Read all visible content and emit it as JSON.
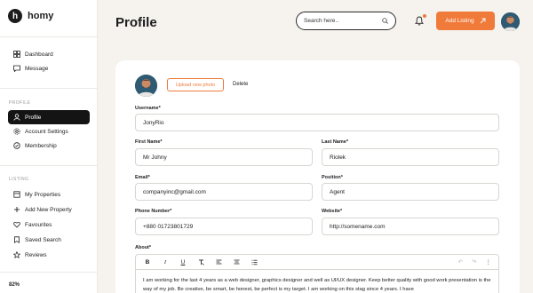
{
  "brand": {
    "name": "homy",
    "mark": "h"
  },
  "sidebar": {
    "main_items": [
      {
        "label": "Dashboard",
        "icon": "dashboard-icon"
      },
      {
        "label": "Message",
        "icon": "message-icon"
      }
    ],
    "profile_section": "PROFILE",
    "profile_items": [
      {
        "label": "Profile",
        "icon": "user-icon",
        "active": true
      },
      {
        "label": "Account Settings",
        "icon": "gear-icon"
      },
      {
        "label": "Membership",
        "icon": "membership-icon"
      }
    ],
    "listing_section": "LISTING",
    "listing_items": [
      {
        "label": "My Properties",
        "icon": "properties-icon"
      },
      {
        "label": "Add New Property",
        "icon": "plus-icon"
      },
      {
        "label": "Favourites",
        "icon": "heart-icon"
      },
      {
        "label": "Saved Search",
        "icon": "bookmark-icon"
      },
      {
        "label": "Reviews",
        "icon": "star-icon"
      }
    ],
    "progress": "82%"
  },
  "header": {
    "title": "Profile",
    "search_placeholder": "Search here..",
    "add_listing_label": "Add Listing"
  },
  "profile": {
    "upload_label": "Upload new photo",
    "delete_label": "Delete",
    "username_label": "Username*",
    "username_value": "JonyRio",
    "first_name_label": "First Name*",
    "first_name_value": "Mr Johny",
    "last_name_label": "Last Name*",
    "last_name_value": "Riolek",
    "email_label": "Email*",
    "email_value": "companyinc@gmail.com",
    "position_label": "Position*",
    "position_value": "Agent",
    "phone_label": "Phone Number*",
    "phone_value": "+880 01723801729",
    "website_label": "Website*",
    "website_value": "http://somename.com",
    "about_label": "About*",
    "about_text": "I am working for the last 4 years as a web designer, graphics designer and well as UI/UX designer. Keep better quality with good work presentation is the way of my job. Be creative, be smart, be honest, be perfect is my target. I am working on this stag since 4 years. I have"
  },
  "colors": {
    "accent": "#f07a3a",
    "dark": "#141414",
    "background": "#f6f3ef"
  }
}
